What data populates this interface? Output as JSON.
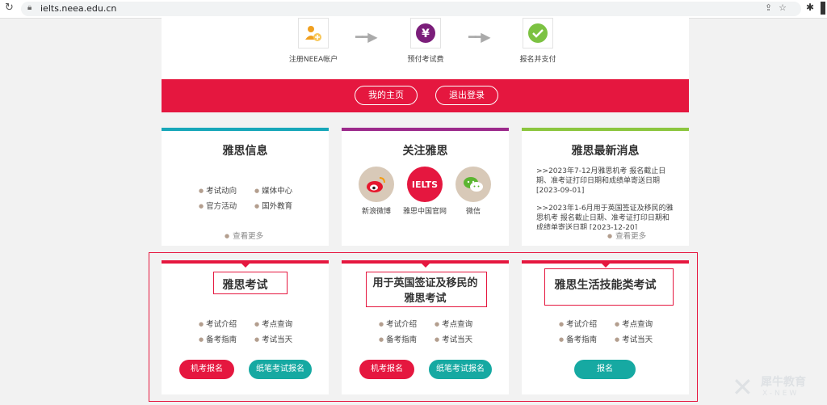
{
  "browser": {
    "url": "ielts.neea.edu.cn",
    "reload_icon": "reload-icon",
    "lock_icon": "lock-icon"
  },
  "steps": [
    {
      "label": "注册NEEA帐户",
      "icon": "user-add-icon"
    },
    {
      "label": "预付考试费",
      "icon": "yen-icon"
    },
    {
      "label": "报名并支付",
      "icon": "check-icon"
    }
  ],
  "nav": {
    "home": "我的主页",
    "logout": "退出登录"
  },
  "info_card": {
    "title": "雅思信息",
    "items": [
      "考试动向",
      "媒体中心",
      "官方活动",
      "国外教育"
    ],
    "more": "查看更多"
  },
  "follow_card": {
    "title": "关注雅思",
    "socials": [
      {
        "label": "新浪微博",
        "icon": "weibo-icon"
      },
      {
        "label": "雅思中国官网",
        "icon": "ielts-logo-icon",
        "logo_text": "IELTS"
      },
      {
        "label": "微信",
        "icon": "wechat-icon"
      }
    ]
  },
  "news_card": {
    "title": "雅思最新消息",
    "items": [
      ">>2023年7-12月雅思机考 报名截止日期、准考证打印日期和成绩单寄送日期 [2023-09-01]",
      ">>2023年1-6月用于英国签证及移民的雅思机考 报名截止日期、准考证打印日期和成绩单寄送日期 [2023-12-20]"
    ],
    "more": "查看更多"
  },
  "exam_cards": [
    {
      "title": "雅思考试",
      "items": [
        "考试介绍",
        "考点查询",
        "备考指南",
        "考试当天"
      ],
      "buttons": [
        "机考报名",
        "纸笔考试报名"
      ]
    },
    {
      "title": "用于英国签证及移民的雅思考试",
      "title_line1": "用于英国签证及移民的",
      "title_line2": "雅思考试",
      "items": [
        "考试介绍",
        "考点查询",
        "备考指南",
        "考试当天"
      ],
      "buttons": [
        "机考报名",
        "纸笔考试报名"
      ]
    },
    {
      "title": "雅思生活技能类考试",
      "items": [
        "考试介绍",
        "考点查询",
        "备考指南",
        "考试当天"
      ],
      "buttons": [
        "报名"
      ]
    }
  ],
  "watermark": {
    "cn": "犀牛教育",
    "en": "X-NEW"
  },
  "colors": {
    "brand_red": "#e5173f",
    "teal": "#16a9a2",
    "purple": "#9c2a8b",
    "green": "#8cc63f",
    "cyan": "#18a7b9"
  }
}
